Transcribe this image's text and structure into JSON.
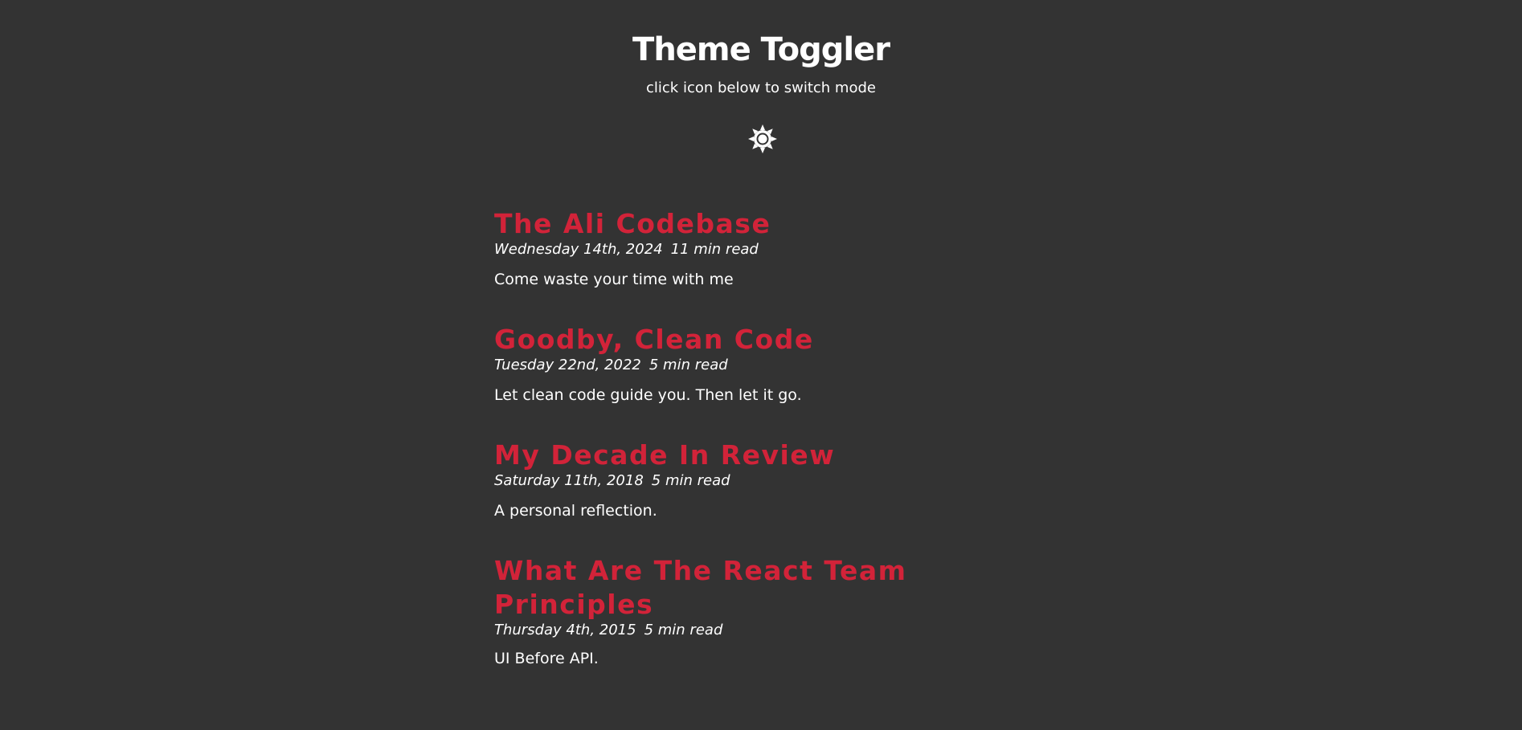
{
  "header": {
    "title": "Theme Toggler",
    "subtitle": "click icon below to switch mode",
    "toggle_icon": "sun-icon"
  },
  "colors": {
    "background": "#333333",
    "text": "#ffffff",
    "accent": "#d22339"
  },
  "posts": [
    {
      "title": "The Ali Codebase",
      "date": "Wednesday 14th, 2024",
      "read_time": "11 min read",
      "excerpt": "Come waste your time with me"
    },
    {
      "title": "Goodby, Clean Code",
      "date": "Tuesday 22nd, 2022",
      "read_time": "5 min read",
      "excerpt": "Let clean code guide you. Then let it go."
    },
    {
      "title": "My Decade In Review",
      "date": "Saturday 11th, 2018",
      "read_time": "5 min read",
      "excerpt": "A personal reflection."
    },
    {
      "title": "What Are The React Team Principles",
      "date": "Thursday 4th, 2015",
      "read_time": "5 min read",
      "excerpt": "UI Before API."
    }
  ]
}
